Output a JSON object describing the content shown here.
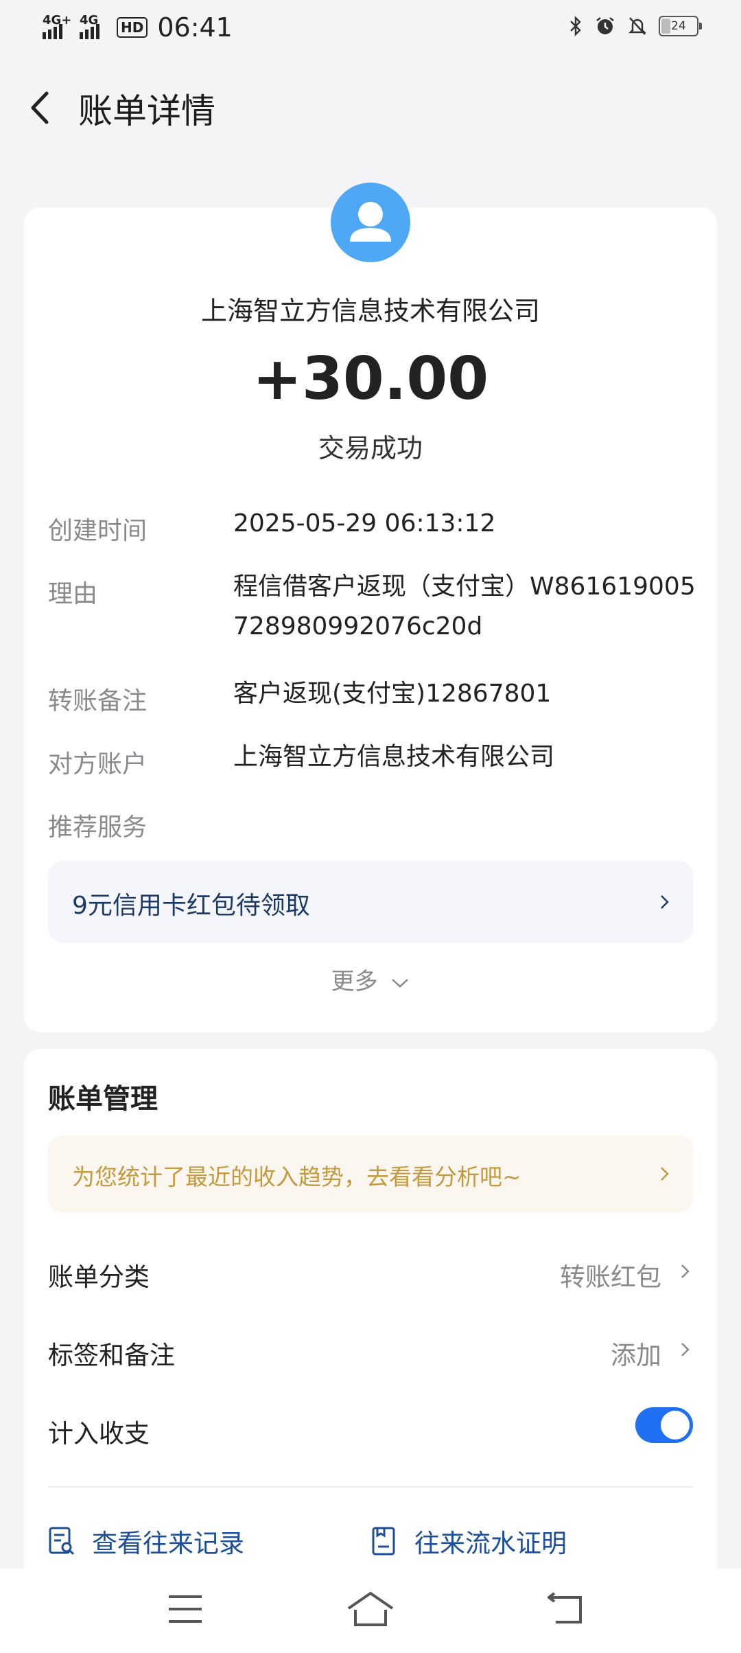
{
  "status_bar": {
    "time": "06:41",
    "signal1": "4G+",
    "signal2": "4G",
    "hd_badge": "HD",
    "battery": "24"
  },
  "header": {
    "title": "账单详情"
  },
  "transaction": {
    "payee": "上海智立方信息技术有限公司",
    "amount": "+30.00",
    "status": "交易成功",
    "details": [
      {
        "label": "创建时间",
        "value": "2025-05-29 06:13:12"
      },
      {
        "label": "理由",
        "value": "程信借客户返现（支付宝）W861619005728980992076c20d"
      },
      {
        "label": "转账备注",
        "value": "客户返现(支付宝)12867801"
      },
      {
        "label": "对方账户",
        "value": "上海智立方信息技术有限公司"
      }
    ],
    "recommend_label": "推荐服务",
    "promo": "9元信用卡红包待领取",
    "more": "更多"
  },
  "management": {
    "title": "账单管理",
    "tip": "为您统计了最近的收入趋势，去看看分析吧~",
    "category_label": "账单分类",
    "category_value": "转账红包",
    "tags_label": "标签和备注",
    "tags_value": "添加",
    "count_label": "计入收支",
    "count_enabled": true,
    "action1": "查看往来记录",
    "action2": "往来流水证明"
  },
  "colors": {
    "accent": "#1f6ff2",
    "avatar": "#4fa8f6",
    "tip_text": "#c49a3e"
  }
}
